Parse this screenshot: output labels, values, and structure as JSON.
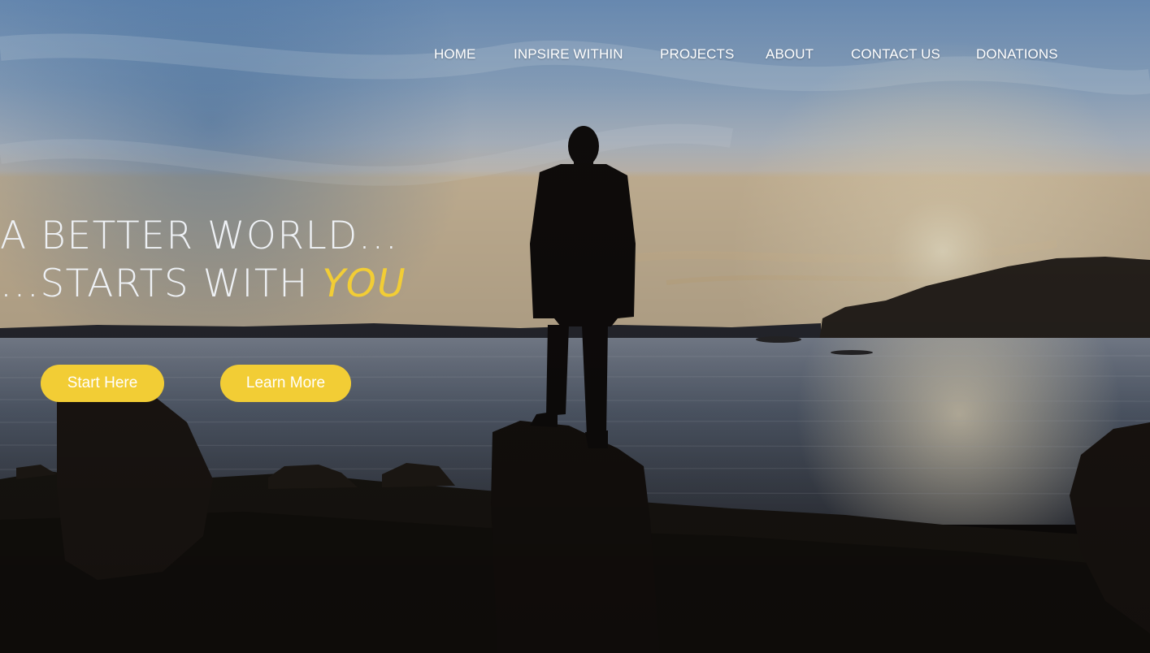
{
  "nav": {
    "items": [
      {
        "label": "HOME"
      },
      {
        "label": "INPSIRE WITHIN"
      },
      {
        "label": "PROJECTS"
      },
      {
        "label": "ABOUT"
      },
      {
        "label": "CONTACT US"
      },
      {
        "label": "DONATIONS"
      }
    ]
  },
  "hero": {
    "line1": "A BETTER WORLD...",
    "line2_prefix": "...STARTS WITH ",
    "line2_highlight": "YOU",
    "primary_button": "Start Here",
    "secondary_button": "Learn More"
  },
  "colors": {
    "accent": "#f2cd35",
    "text": "#ffffff"
  }
}
